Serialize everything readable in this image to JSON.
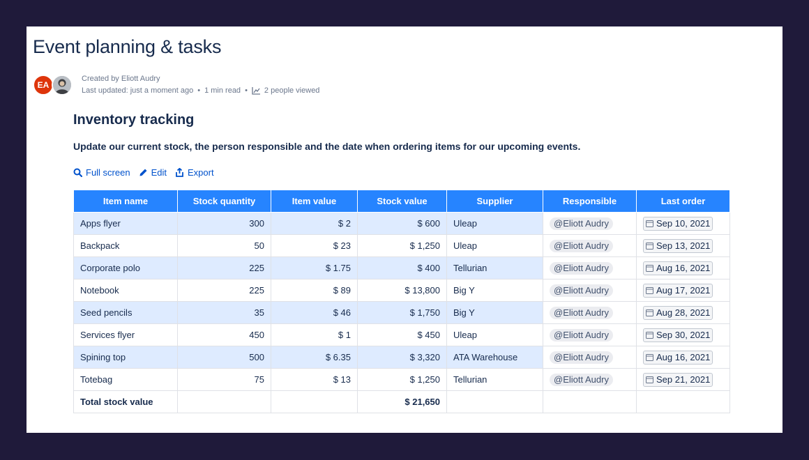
{
  "page": {
    "title": "Event planning & tasks",
    "byline": {
      "avatar_initials": "EA",
      "created_by": "Created by Eliott Audry",
      "last_updated": "Last updated: just a moment ago",
      "read_time": "1 min read",
      "views": "2 people viewed"
    }
  },
  "section": {
    "heading": "Inventory tracking",
    "description": "Update our current stock, the person responsible and the date when ordering items for our upcoming events."
  },
  "toolbar": {
    "full_screen": "Full screen",
    "edit": "Edit",
    "export": "Export"
  },
  "table": {
    "headers": [
      "Item name",
      "Stock quantity",
      "Item value",
      "Stock value",
      "Supplier",
      "Responsible",
      "Last order"
    ],
    "rows": [
      {
        "item": "Apps flyer",
        "qty": "300",
        "value": "$ 2",
        "stock": "$ 600",
        "supplier": "Uleap",
        "responsible": "@Eliott Audry",
        "last_order": "Sep 10, 2021"
      },
      {
        "item": "Backpack",
        "qty": "50",
        "value": "$ 23",
        "stock": "$ 1,250",
        "supplier": "Uleap",
        "responsible": "@Eliott Audry",
        "last_order": "Sep 13, 2021"
      },
      {
        "item": "Corporate polo",
        "qty": "225",
        "value": "$ 1.75",
        "stock": "$ 400",
        "supplier": "Tellurian",
        "responsible": "@Eliott Audry",
        "last_order": "Aug 16, 2021"
      },
      {
        "item": "Notebook",
        "qty": "225",
        "value": "$ 89",
        "stock": "$ 13,800",
        "supplier": "Big Y",
        "responsible": "@Eliott Audry",
        "last_order": "Aug 17, 2021"
      },
      {
        "item": "Seed pencils",
        "qty": "35",
        "value": "$ 46",
        "stock": "$ 1,750",
        "supplier": "Big Y",
        "responsible": "@Eliott Audry",
        "last_order": "Aug 28, 2021"
      },
      {
        "item": "Services flyer",
        "qty": "450",
        "value": "$ 1",
        "stock": "$ 450",
        "supplier": "Uleap",
        "responsible": "@Eliott Audry",
        "last_order": "Sep 30, 2021"
      },
      {
        "item": "Spining top",
        "qty": "500",
        "value": "$ 6.35",
        "stock": "$ 3,320",
        "supplier": "ATA Warehouse",
        "responsible": "@Eliott Audry",
        "last_order": "Aug 16, 2021"
      },
      {
        "item": "Totebag",
        "qty": "75",
        "value": "$ 13",
        "stock": "$ 1,250",
        "supplier": "Tellurian",
        "responsible": "@Eliott Audry",
        "last_order": "Sep 21, 2021"
      }
    ],
    "total": {
      "label": "Total stock value",
      "value": "$ 21,650"
    }
  },
  "colors": {
    "header_bg": "#2684ff",
    "row_highlight": "#deebff",
    "link": "#0052cc",
    "avatar": "#de350b",
    "backdrop": "#1f1a3a"
  }
}
